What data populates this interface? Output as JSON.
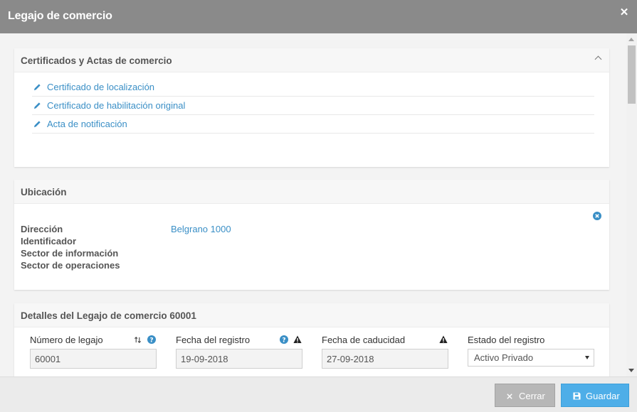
{
  "modal": {
    "title": "Legajo de comercio",
    "close_icon": "close-x-icon"
  },
  "colors": {
    "titlebar": "#8a8a8a",
    "link": "#3a8fc6",
    "primary_button": "#4eaee8",
    "secondary_button": "#b7b7b7"
  },
  "certificados": {
    "title": "Certificados y Actas de comercio",
    "collapse_icon": "chevron-up-icon",
    "items": [
      {
        "icon": "pencil-icon",
        "label": "Certificado de localización"
      },
      {
        "icon": "pencil-icon",
        "label": "Certificado de habilitación original"
      },
      {
        "icon": "pencil-icon",
        "label": "Acta de notificación"
      }
    ]
  },
  "ubicacion": {
    "title": "Ubicación",
    "remove_icon": "remove-circle-icon",
    "rows": [
      {
        "label": "Dirección",
        "value": "Belgrano 1000"
      },
      {
        "label": "Identificador",
        "value": ""
      },
      {
        "label": "Sector de información",
        "value": ""
      },
      {
        "label": "Sector de operaciones",
        "value": ""
      }
    ]
  },
  "detalles": {
    "title": "Detalles del Legajo de comercio 60001",
    "fields": [
      {
        "label": "Número de legajo",
        "value": "60001",
        "icons": [
          "sort-arrows-icon",
          "help-icon"
        ]
      },
      {
        "label": "Fecha del registro",
        "value": "19-09-2018",
        "icons": [
          "help-icon",
          "warning-icon"
        ]
      },
      {
        "label": "Fecha de caducidad",
        "value": "27-09-2018",
        "icons": [
          "warning-icon"
        ]
      },
      {
        "label": "Estado del registro",
        "value": "Activo Privado",
        "icons": [
          "dropdown-caret-icon"
        ]
      }
    ]
  },
  "footer": {
    "cerrar_label": "Cerrar",
    "cerrar_icon": "close-x-icon",
    "guardar_label": "Guardar",
    "guardar_icon": "save-floppy-icon"
  }
}
